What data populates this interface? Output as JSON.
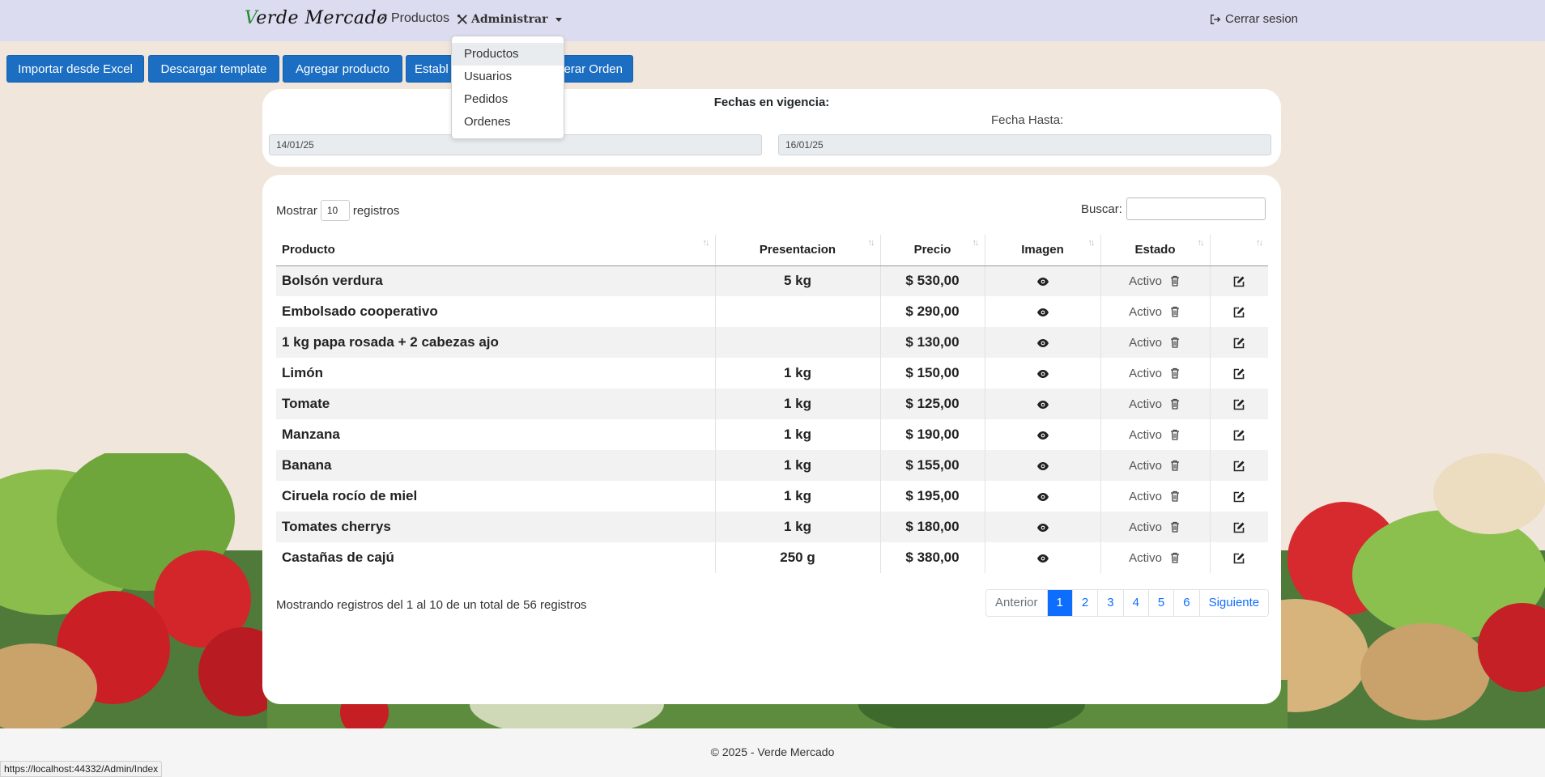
{
  "navbar": {
    "brand": "Verde Mercado",
    "brand_first": "V",
    "brand_rest": "erde Mercado",
    "productos": "Productos",
    "administrar": "Administrar",
    "logout": "Cerrar sesion"
  },
  "dropdown": {
    "items": [
      "Productos",
      "Usuarios",
      "Pedidos",
      "Ordenes"
    ],
    "active": "Productos"
  },
  "toolbar": {
    "import": "Importar desde Excel",
    "template": "Descargar template",
    "add": "Agregar producto",
    "establish": "Establ",
    "order": "erar Orden"
  },
  "dates": {
    "title": "Fechas en vigencia:",
    "to_label": "Fecha Hasta:",
    "from_value": "14/01/25",
    "to_value": "16/01/25"
  },
  "table_controls": {
    "show_label": "Mostrar",
    "show_value": "10",
    "records_label": "registros",
    "search_label": "Buscar:"
  },
  "table": {
    "headers": [
      "Producto",
      "Presentacion",
      "Precio",
      "Imagen",
      "Estado",
      ""
    ],
    "rows": [
      {
        "producto": "Bolsón verdura",
        "presentacion": "5 kg",
        "precio": "$ 530,00",
        "estado": "Activo"
      },
      {
        "producto": "Embolsado cooperativo",
        "presentacion": "",
        "precio": "$ 290,00",
        "estado": "Activo"
      },
      {
        "producto": "1 kg papa rosada + 2 cabezas ajo",
        "presentacion": "",
        "precio": "$ 130,00",
        "estado": "Activo"
      },
      {
        "producto": "Limón",
        "presentacion": "1 kg",
        "precio": "$ 150,00",
        "estado": "Activo"
      },
      {
        "producto": "Tomate",
        "presentacion": "1 kg",
        "precio": "$ 125,00",
        "estado": "Activo"
      },
      {
        "producto": "Manzana",
        "presentacion": "1 kg",
        "precio": "$ 190,00",
        "estado": "Activo"
      },
      {
        "producto": "Banana",
        "presentacion": "1 kg",
        "precio": "$ 155,00",
        "estado": "Activo"
      },
      {
        "producto": "Ciruela rocío de miel",
        "presentacion": "1 kg",
        "precio": "$ 195,00",
        "estado": "Activo"
      },
      {
        "producto": "Tomates cherrys",
        "presentacion": "1 kg",
        "precio": "$ 180,00",
        "estado": "Activo"
      },
      {
        "producto": "Castañas de cajú",
        "presentacion": "250 g",
        "precio": "$ 380,00",
        "estado": "Activo"
      }
    ]
  },
  "pagination": {
    "info": "Mostrando registros del 1 al 10 de un total de 56 registros",
    "previous": "Anterior",
    "pages": [
      "1",
      "2",
      "3",
      "4",
      "5",
      "6"
    ],
    "current": "1",
    "next": "Siguiente"
  },
  "footer": {
    "text": "© 2025 - Verde Mercado"
  },
  "status_bar": {
    "url": "https://localhost:44332/Admin/Index"
  },
  "icons": {
    "productos": "carrot-icon",
    "administrar": "tools-icon",
    "logout": "sign-out-icon",
    "imagen": "eye-icon",
    "delete": "trash-icon",
    "edit": "edit-icon"
  },
  "colors": {
    "navbar": "#dcdcf0",
    "primary_button": "#1b6ec2",
    "page_active": "#0d6efd",
    "brand_accent": "#1f8a2f"
  }
}
